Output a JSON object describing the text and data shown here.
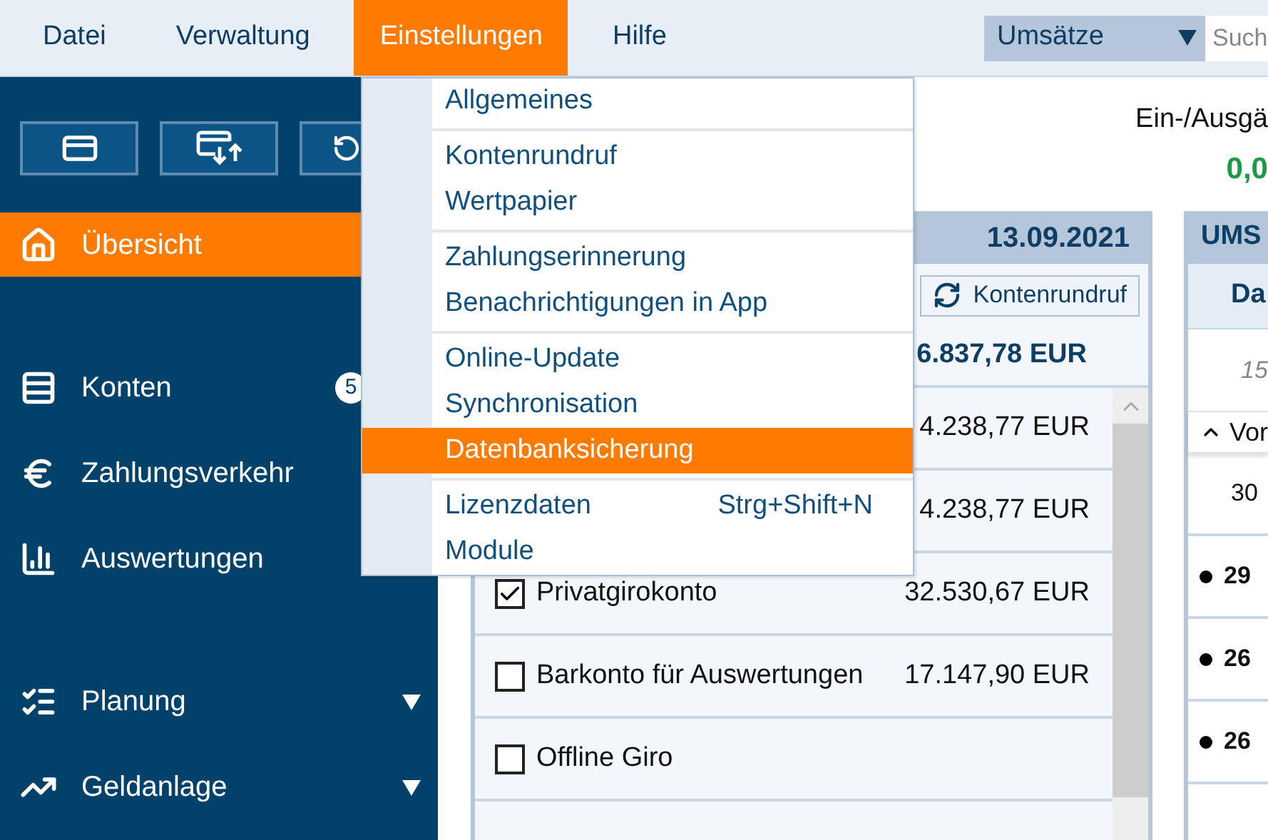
{
  "menu_bar": {
    "items": [
      {
        "label": "Datei",
        "selected": false
      },
      {
        "label": "Verwaltung",
        "selected": false
      },
      {
        "label": "Einstellungen",
        "selected": true
      },
      {
        "label": "Hilfe",
        "selected": false
      }
    ],
    "view_select": {
      "value": "Umsätze"
    },
    "search": {
      "placeholder": "Such"
    }
  },
  "sidebar": {
    "groups": [
      {
        "items": [
          {
            "label": "Übersicht",
            "selected": true
          }
        ]
      },
      {
        "items": [
          {
            "label": "Konten",
            "selected": false,
            "badge": "5"
          },
          {
            "label": "Zahlungsverkehr",
            "selected": false
          },
          {
            "label": "Auswertungen",
            "selected": false
          }
        ]
      },
      {
        "items": [
          {
            "label": "Planung",
            "selected": false,
            "expanded": false
          },
          {
            "label": "Geldanlage",
            "selected": false,
            "expanded": false
          }
        ]
      }
    ]
  },
  "summary": {
    "label": "Ein-/Ausgä",
    "value": "0,0"
  },
  "accounts_panel": {
    "date": "13.09.2021",
    "refresh_button": "Kontenrundruf",
    "total": "6.837,78 EUR",
    "rows": [
      {
        "amount": "4.238,77 EUR"
      },
      {
        "amount": "4.238,77 EUR"
      },
      {
        "name": "Privatgirokonto",
        "checked": true,
        "amount": "32.530,67 EUR"
      },
      {
        "name": "Barkonto für Auswertungen",
        "checked": false,
        "amount": "17.147,90 EUR"
      },
      {
        "name": "Offline Giro",
        "checked": false
      }
    ]
  },
  "transactions_panel": {
    "title": "UMS",
    "column_1": "Da",
    "first_row": "15",
    "group_toggle": "Vor",
    "rows": [
      {
        "text": "30",
        "marked": false
      },
      {
        "text": "29",
        "marked": true
      },
      {
        "text": "26",
        "marked": true
      },
      {
        "text": "26",
        "marked": true
      }
    ]
  },
  "settings_menu": {
    "groups": [
      {
        "items": [
          {
            "label": "Allgemeines",
            "selected": false
          }
        ]
      },
      {
        "items": [
          {
            "label": "Kontenrundruf",
            "selected": false
          },
          {
            "label": "Wertpapier",
            "selected": false
          }
        ]
      },
      {
        "items": [
          {
            "label": "Zahlungserinnerung",
            "selected": false
          },
          {
            "label": "Benachrichtigungen in App",
            "selected": false
          }
        ]
      },
      {
        "items": [
          {
            "label": "Online-Update",
            "selected": false
          },
          {
            "label": "Synchronisation",
            "selected": false
          },
          {
            "label": "Datenbanksicherung",
            "selected": true
          }
        ]
      },
      {
        "items": [
          {
            "label": "Lizenzdaten",
            "selected": false,
            "shortcut": "Strg+Shift+N"
          },
          {
            "label": "Module",
            "selected": false
          }
        ]
      }
    ]
  }
}
